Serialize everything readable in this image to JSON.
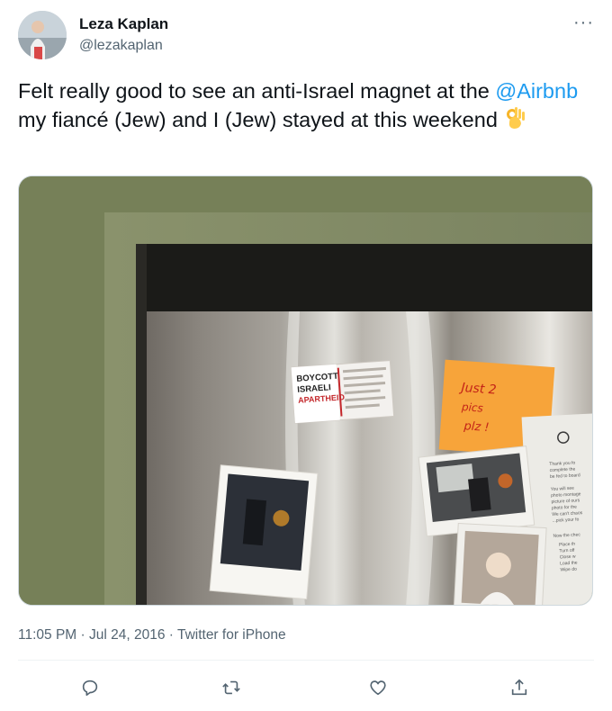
{
  "tweet": {
    "author_name": "Leza Kaplan",
    "author_handle": "@lezakaplan",
    "more_icon": "more-dots-icon",
    "text_before": "Felt really good to see an anti-Israel magnet at the ",
    "mention": "@Airbnb",
    "text_after": " my fiancé (Jew) and I (Jew) stayed at this weekend ",
    "emoji": "ok-hand-emoji",
    "time": "11:05 PM",
    "separator_1": " · ",
    "date": "Jul 24, 2016",
    "separator_2": " · ",
    "source": "Twitter for iPhone"
  },
  "photo": {
    "magnet_lines": [
      "BOYCOTT",
      "ISRAELI",
      "APARTHEID"
    ],
    "sticky_note_lines": [
      "Just 2",
      "pics",
      "plz !"
    ],
    "note_text": [
      "Thank you fo",
      "complete the",
      "be fed to board",
      "You will see",
      "photo montage",
      "picture of ours",
      "photo for the",
      "We can't chaos",
      "...pick your fo",
      "Now the chec",
      "Place th",
      "Turn off",
      "Close w",
      "Load the",
      "Wipe do"
    ]
  },
  "actions": {
    "reply_icon": "reply-icon",
    "retweet_icon": "retweet-icon",
    "like_icon": "heart-icon",
    "share_icon": "share-icon"
  },
  "colors": {
    "link": "#1d9bf0",
    "secondary_text": "#536471",
    "primary_text": "#0f1419"
  }
}
